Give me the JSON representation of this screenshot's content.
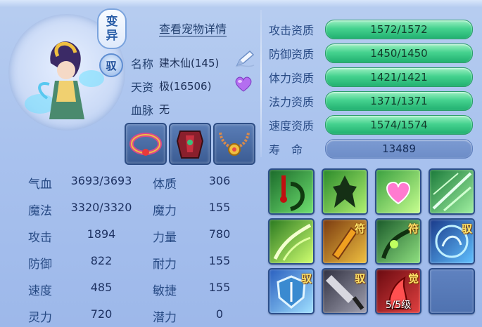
{
  "header": {
    "detail_link": "查看宠物详情"
  },
  "badges": {
    "variant_line1": "变",
    "variant_line2": "异",
    "tame": "驭"
  },
  "pet": {
    "name_label": "名称",
    "name_value": "建木仙(145)",
    "talent_label": "天资",
    "talent_value": "极(16506)",
    "bloodline_label": "血脉",
    "bloodline_value": "无"
  },
  "icons": {
    "edit": "edit-pencil-icon",
    "heart": "purple-heart-icon"
  },
  "equipment": [
    {
      "name": "equip-slot-1"
    },
    {
      "name": "equip-slot-2"
    },
    {
      "name": "equip-slot-3"
    }
  ],
  "stats": [
    {
      "label": "气血",
      "value": "3693/3693",
      "label2": "体质",
      "value2": "306"
    },
    {
      "label": "魔法",
      "value": "3320/3320",
      "label2": "魔力",
      "value2": "155"
    },
    {
      "label": "攻击",
      "value": "1894",
      "label2": "力量",
      "value2": "780"
    },
    {
      "label": "防御",
      "value": "822",
      "label2": "耐力",
      "value2": "155"
    },
    {
      "label": "速度",
      "value": "485",
      "label2": "敏捷",
      "value2": "155"
    },
    {
      "label": "灵力",
      "value": "720",
      "label2": "潜力",
      "value2": "0"
    }
  ],
  "aptitudes": [
    {
      "label": "攻击资质",
      "value": "1572/1572",
      "fill": 1.0
    },
    {
      "label": "防御资质",
      "value": "1450/1450",
      "fill": 1.0
    },
    {
      "label": "体力资质",
      "value": "1421/1421",
      "fill": 1.0
    },
    {
      "label": "法力资质",
      "value": "1371/1371",
      "fill": 1.0
    },
    {
      "label": "速度资质",
      "value": "1574/1574",
      "fill": 1.0
    }
  ],
  "lifespan": {
    "label": "寿　命",
    "value": "13489"
  },
  "skills": [
    {
      "tag": "",
      "sub": ""
    },
    {
      "tag": "",
      "sub": ""
    },
    {
      "tag": "",
      "sub": ""
    },
    {
      "tag": "",
      "sub": ""
    },
    {
      "tag": "",
      "sub": ""
    },
    {
      "tag": "符",
      "sub": ""
    },
    {
      "tag": "符",
      "sub": ""
    },
    {
      "tag": "驭",
      "sub": ""
    },
    {
      "tag": "驭",
      "sub": ""
    },
    {
      "tag": "驭",
      "sub": ""
    },
    {
      "tag": "觉",
      "sub": "5/5级"
    },
    {
      "tag": "",
      "sub": ""
    }
  ],
  "colors": {
    "aptitude_bar": "#45d28f",
    "lifespan_bar": "#6d8dc8",
    "panel_bg": "#a9c2ee",
    "skill_tag": "#ffe56a"
  }
}
